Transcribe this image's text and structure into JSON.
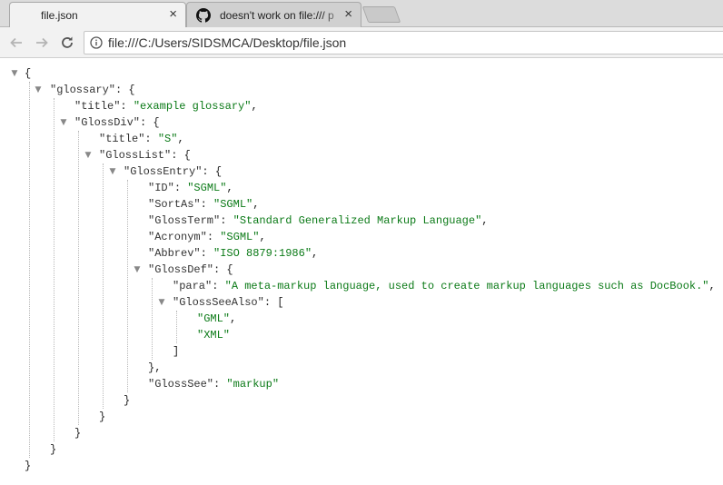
{
  "tabs": [
    {
      "title": "file.json",
      "close": "×"
    },
    {
      "title": "doesn't work on file:/// p",
      "close": "×"
    }
  ],
  "toolbar": {
    "url": "file:///C:/Users/SIDSMCA/Desktop/file.json"
  },
  "icons": {
    "back": "arrow-left-icon",
    "forward": "arrow-right-icon",
    "reload": "reload-icon",
    "info": "info-icon",
    "github": "github-icon",
    "toggle": "triangle-down-icon"
  },
  "json": {
    "root_open": "{",
    "glossary_key": "\"glossary\"",
    "title_key": "\"title\"",
    "title_val": "\"example glossary\"",
    "glossdiv_key": "\"GlossDiv\"",
    "div_title_key": "\"title\"",
    "div_title_val": "\"S\"",
    "glosslist_key": "\"GlossList\"",
    "glossentry_key": "\"GlossEntry\"",
    "id_key": "\"ID\"",
    "id_val": "\"SGML\"",
    "sortas_key": "\"SortAs\"",
    "sortas_val": "\"SGML\"",
    "glossterm_key": "\"GlossTerm\"",
    "glossterm_val": "\"Standard Generalized Markup Language\"",
    "acronym_key": "\"Acronym\"",
    "acronym_val": "\"SGML\"",
    "abbrev_key": "\"Abbrev\"",
    "abbrev_val": "\"ISO 8879:1986\"",
    "glossdef_key": "\"GlossDef\"",
    "para_key": "\"para\"",
    "para_val": "\"A meta-markup language, used to create markup languages such as DocBook.\"",
    "seealso_key": "\"GlossSeeAlso\"",
    "gml_val": "\"GML\"",
    "xml_val": "\"XML\"",
    "glosssee_key": "\"GlossSee\"",
    "glosssee_val": "\"markup\""
  }
}
